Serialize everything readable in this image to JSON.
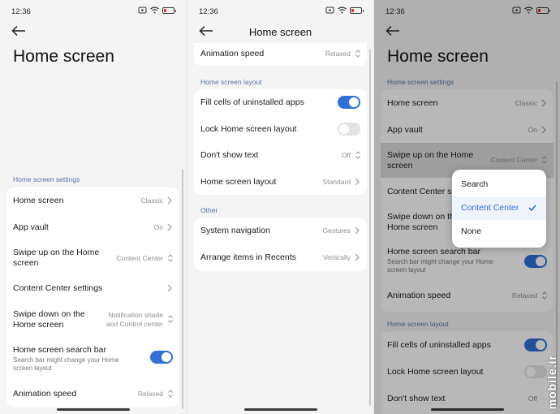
{
  "status": {
    "time": "12:36"
  },
  "colors": {
    "accent": "#2f6fd6",
    "section": "#5a72a0",
    "battery_low": "#e53935"
  },
  "icons": [
    "back-arrow-icon",
    "chevron-right-icon",
    "updown-chevron-icon",
    "check-icon",
    "wifi-icon",
    "signal-icon",
    "battery-icon"
  ],
  "panel1": {
    "title": "Home screen",
    "section": "Home screen settings",
    "rows": [
      {
        "label": "Home screen",
        "value": "Classic"
      },
      {
        "label": "App vault",
        "value": "On"
      },
      {
        "label": "Swipe up on the Home screen",
        "value": "Content Center"
      },
      {
        "label": "Content Center settings"
      },
      {
        "label": "Swipe down on the Home screen",
        "value": "Notification shade and Control center"
      },
      {
        "label": "Home screen search bar",
        "sub": "Search bar might change your Home screen layout",
        "toggle": true
      },
      {
        "label": "Animation speed",
        "value": "Relaxed"
      }
    ]
  },
  "panel2": {
    "title": "Home screen",
    "top_row": {
      "label": "Animation speed",
      "value": "Relaxed"
    },
    "section_layout": "Home screen layout",
    "layout_rows": [
      {
        "label": "Fill cells of uninstalled apps",
        "toggle": true
      },
      {
        "label": "Lock Home screen layout",
        "toggle": false
      },
      {
        "label": "Don't show text",
        "value": "Off"
      },
      {
        "label": "Home screen layout",
        "value": "Standard"
      }
    ],
    "section_other": "Other",
    "other_rows": [
      {
        "label": "System navigation",
        "value": "Gestures"
      },
      {
        "label": "Arrange items in Recents",
        "value": "Vertically"
      }
    ]
  },
  "panel3": {
    "title": "Home screen",
    "section": "Home screen settings",
    "rows": [
      {
        "label": "Home screen",
        "value": "Classic"
      },
      {
        "label": "App vault",
        "value": "On"
      },
      {
        "label": "Swipe up on the Home screen",
        "value": "Content Center"
      },
      {
        "label": "Content Center se"
      },
      {
        "label": "Swipe down on th",
        "label2": "Home screen"
      },
      {
        "label": "Home screen search bar",
        "sub": "Search bar might change your Home screen layout",
        "toggle": true
      },
      {
        "label": "Animation speed",
        "value": "Relaxed"
      }
    ],
    "section_layout": "Home screen layout",
    "layout_rows": [
      {
        "label": "Fill cells of uninstalled apps",
        "toggle": true
      },
      {
        "label": "Lock Home screen layout",
        "toggle": false
      },
      {
        "label": "Don't show text",
        "value": "Off"
      }
    ],
    "dropdown": {
      "options": [
        "Search",
        "Content Center",
        "None"
      ],
      "selected": "Content Center"
    }
  },
  "watermark": "mobile.ir"
}
